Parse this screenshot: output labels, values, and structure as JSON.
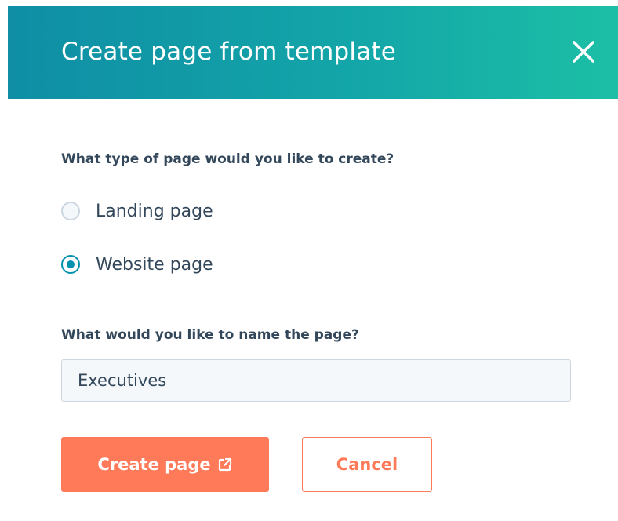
{
  "dialog": {
    "title": "Create page from template",
    "close_icon": "close-icon"
  },
  "page_type": {
    "question": "What type of page would you like to create?",
    "options": [
      {
        "label": "Landing page",
        "selected": false
      },
      {
        "label": "Website page",
        "selected": true
      }
    ]
  },
  "page_name": {
    "question": "What would you like to name the page?",
    "value": "Executives"
  },
  "actions": {
    "create_label": "Create page",
    "create_icon": "external-link-icon",
    "cancel_label": "Cancel"
  },
  "colors": {
    "header_gradient_start": "#0f8ea5",
    "header_gradient_end": "#1cbfa6",
    "primary": "#ff7a59",
    "radio_accent": "#0091ae",
    "text": "#33475b",
    "input_bg": "#f5f8fa"
  }
}
